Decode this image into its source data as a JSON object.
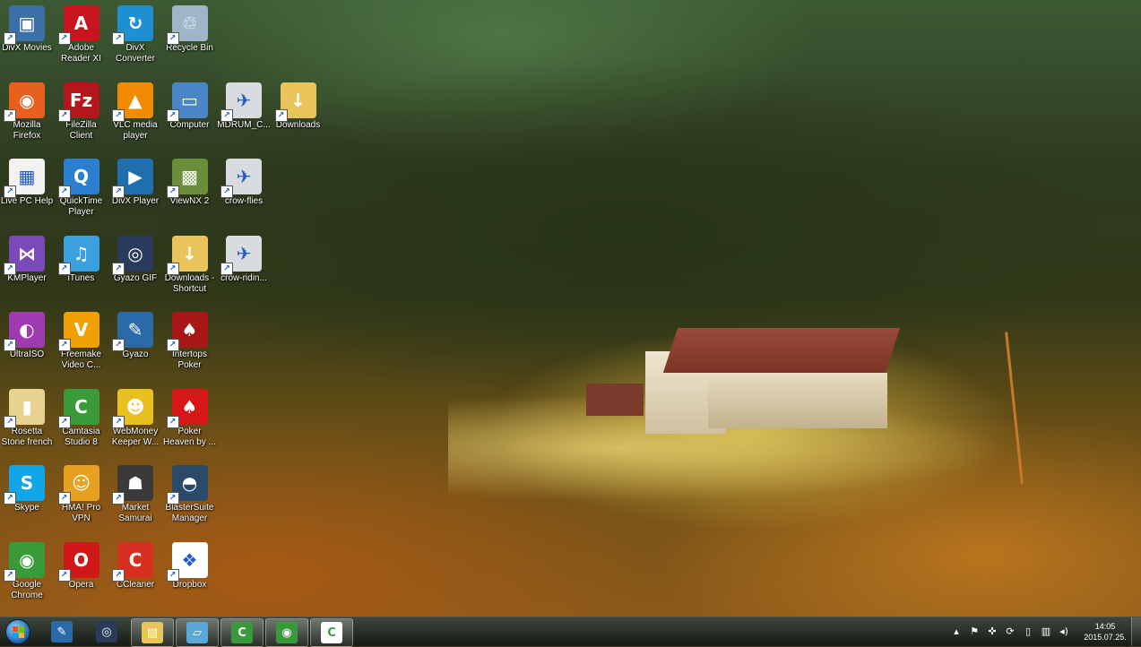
{
  "desktop_icons": [
    {
      "label": "DivX Movies",
      "icon": "divx-movies-icon",
      "color": "#3a6fa8",
      "glyph": "▣",
      "col": 0,
      "row": 0
    },
    {
      "label": "Adobe Reader XI",
      "icon": "adobe-reader-icon",
      "color": "#c8141e",
      "glyph": "A",
      "col": 1,
      "row": 0
    },
    {
      "label": "DivX Converter",
      "icon": "divx-converter-icon",
      "color": "#1e8fd0",
      "glyph": "↻",
      "col": 2,
      "row": 0
    },
    {
      "label": "Recycle Bin",
      "icon": "recycle-bin-icon",
      "color": "#9fb6c8",
      "glyph": "♲",
      "col": 3,
      "row": 0
    },
    {
      "label": "Mozilla Firefox",
      "icon": "firefox-icon",
      "color": "#e8601e",
      "glyph": "◉",
      "col": 0,
      "row": 1
    },
    {
      "label": "FileZilla Client",
      "icon": "filezilla-icon",
      "color": "#b4161b",
      "glyph": "Fz",
      "col": 1,
      "row": 1
    },
    {
      "label": "VLC media player",
      "icon": "vlc-icon",
      "color": "#f08a00",
      "glyph": "▲",
      "col": 2,
      "row": 1
    },
    {
      "label": "Computer",
      "icon": "computer-icon",
      "color": "#4a86c8",
      "glyph": "▭",
      "col": 3,
      "row": 1
    },
    {
      "label": "MDRUM_C...",
      "icon": "image-thumbnail-icon",
      "color": "#d8dce0",
      "glyph": "✈",
      "col": 4,
      "row": 1
    },
    {
      "label": "Downloads",
      "icon": "downloads-folder-icon",
      "color": "#e8c45a",
      "glyph": "↓",
      "col": 5,
      "row": 1
    },
    {
      "label": "Live PC Help",
      "icon": "live-pc-help-icon",
      "color": "#f2f2f2",
      "glyph": "▦",
      "col": 0,
      "row": 2
    },
    {
      "label": "QuickTime Player",
      "icon": "quicktime-icon",
      "color": "#2a7fd0",
      "glyph": "Q",
      "col": 1,
      "row": 2
    },
    {
      "label": "DivX Player",
      "icon": "divx-player-icon",
      "color": "#1e6fb0",
      "glyph": "▶",
      "col": 2,
      "row": 2
    },
    {
      "label": "ViewNX 2",
      "icon": "viewnx-icon",
      "color": "#6b8e3a",
      "glyph": "▩",
      "col": 3,
      "row": 2
    },
    {
      "label": "crow-flies",
      "icon": "image-thumbnail-icon",
      "color": "#d8dce0",
      "glyph": "✈",
      "col": 4,
      "row": 2
    },
    {
      "label": "KMPlayer",
      "icon": "kmplayer-icon",
      "color": "#7a4ab8",
      "glyph": "⋈",
      "col": 0,
      "row": 3
    },
    {
      "label": "iTunes",
      "icon": "itunes-icon",
      "color": "#3aa0e0",
      "glyph": "♫",
      "col": 1,
      "row": 3
    },
    {
      "label": "Gyazo GIF",
      "icon": "gyazo-gif-icon",
      "color": "#2a3a5a",
      "glyph": "◎",
      "col": 2,
      "row": 3
    },
    {
      "label": "Downloads - Shortcut",
      "icon": "downloads-shortcut-icon",
      "color": "#e8c45a",
      "glyph": "↓",
      "col": 3,
      "row": 3
    },
    {
      "label": "crow-ridin...",
      "icon": "image-thumbnail-icon",
      "color": "#d8dce0",
      "glyph": "✈",
      "col": 4,
      "row": 3
    },
    {
      "label": "UltraISO",
      "icon": "ultraiso-icon",
      "color": "#a03ab0",
      "glyph": "◐",
      "col": 0,
      "row": 4
    },
    {
      "label": "Freemake Video C...",
      "icon": "freemake-icon",
      "color": "#f0a000",
      "glyph": "V",
      "col": 1,
      "row": 4
    },
    {
      "label": "Gyazo",
      "icon": "gyazo-icon",
      "color": "#2a6aa8",
      "glyph": "✎",
      "col": 2,
      "row": 4
    },
    {
      "label": "Intertops Poker",
      "icon": "intertops-poker-icon",
      "color": "#a81818",
      "glyph": "♠",
      "col": 3,
      "row": 4
    },
    {
      "label": "Rosetta Stone french",
      "icon": "rosetta-stone-icon",
      "color": "#e8d290",
      "glyph": "▮",
      "col": 0,
      "row": 5
    },
    {
      "label": "Camtasia Studio 8",
      "icon": "camtasia-icon",
      "color": "#3a9a3a",
      "glyph": "C",
      "col": 1,
      "row": 5
    },
    {
      "label": "WebMoney Keeper W...",
      "icon": "webmoney-icon",
      "color": "#e8c020",
      "glyph": "☻",
      "col": 2,
      "row": 5
    },
    {
      "label": "Poker Heaven by ...",
      "icon": "poker-heaven-icon",
      "color": "#d81818",
      "glyph": "♠",
      "col": 3,
      "row": 5
    },
    {
      "label": "Skype",
      "icon": "skype-icon",
      "color": "#12a5e8",
      "glyph": "S",
      "col": 0,
      "row": 6
    },
    {
      "label": "HMA! Pro VPN",
      "icon": "hma-vpn-icon",
      "color": "#e8a020",
      "glyph": "☺",
      "col": 1,
      "row": 6
    },
    {
      "label": "Market Samurai",
      "icon": "market-samurai-icon",
      "color": "#3a3a3a",
      "glyph": "☗",
      "col": 2,
      "row": 6
    },
    {
      "label": "BlasterSuite Manager",
      "icon": "blastersuite-icon",
      "color": "#2a4a6a",
      "glyph": "◓",
      "col": 3,
      "row": 6
    },
    {
      "label": "Google Chrome",
      "icon": "chrome-icon",
      "color": "#3a9a3a",
      "glyph": "◉",
      "col": 0,
      "row": 7
    },
    {
      "label": "Opera",
      "icon": "opera-icon",
      "color": "#d01818",
      "glyph": "O",
      "col": 1,
      "row": 7
    },
    {
      "label": "CCleaner",
      "icon": "ccleaner-icon",
      "color": "#d83020",
      "glyph": "C",
      "col": 2,
      "row": 7
    },
    {
      "label": "Dropbox",
      "icon": "dropbox-icon",
      "color": "#ffffff",
      "glyph": "❖",
      "col": 3,
      "row": 7
    }
  ],
  "taskbar": {
    "start_label": "Start",
    "pinned": [
      {
        "icon": "gyazo-taskbar-icon",
        "color": "#2a6aa8",
        "glyph": "✎",
        "active": false
      },
      {
        "icon": "gyazo-gif-taskbar-icon",
        "color": "#2a3a5a",
        "glyph": "◎",
        "active": false
      },
      {
        "icon": "file-explorer-icon",
        "color": "#e8c45a",
        "glyph": "▤",
        "active": true
      },
      {
        "icon": "window-switcher-icon",
        "color": "#5aa8d8",
        "glyph": "▱",
        "active": true
      },
      {
        "icon": "camtasia-taskbar-icon",
        "color": "#3a9a3a",
        "glyph": "C",
        "active": true
      },
      {
        "icon": "chrome-taskbar-icon",
        "color": "#3a9a3a",
        "glyph": "◉",
        "active": true
      },
      {
        "icon": "camtasia-recorder-icon",
        "color": "#ffffff",
        "glyph": "C",
        "active": true
      }
    ],
    "tray": [
      {
        "icon": "show-hidden-icons-icon",
        "glyph": "▴"
      },
      {
        "icon": "action-center-flag-icon",
        "glyph": "⚑"
      },
      {
        "icon": "security-icon",
        "glyph": "✜"
      },
      {
        "icon": "sync-icon",
        "glyph": "⟳"
      },
      {
        "icon": "usb-device-icon",
        "glyph": "▯"
      },
      {
        "icon": "network-icon",
        "glyph": "▥"
      },
      {
        "icon": "volume-icon",
        "glyph": "◂)"
      }
    ],
    "clock_time": "14:05",
    "clock_date": "2015.07.25."
  }
}
